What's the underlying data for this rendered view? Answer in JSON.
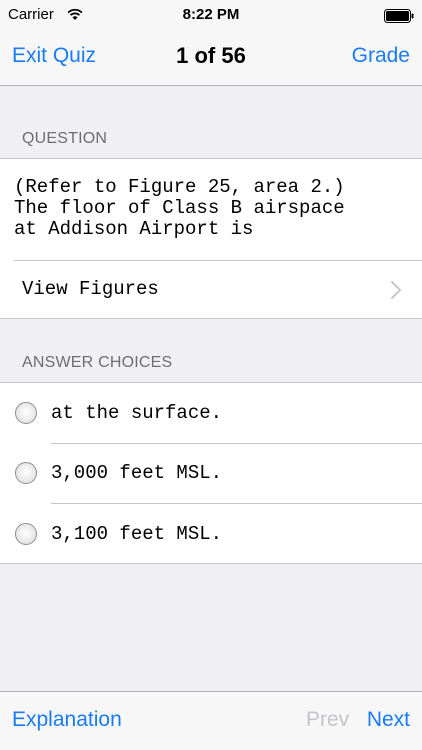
{
  "status_bar": {
    "carrier": "Carrier",
    "time": "8:22 PM"
  },
  "nav": {
    "left_label": "Exit Quiz",
    "title": "1 of 56",
    "right_label": "Grade"
  },
  "question_section": {
    "header": "QUESTION",
    "text": "(Refer to Figure 25, area 2.)\nThe floor of Class B airspace\nat Addison Airport is",
    "view_figures_label": "View Figures"
  },
  "answers_section": {
    "header": "ANSWER CHOICES",
    "choices": [
      {
        "label": "at the surface."
      },
      {
        "label": "3,000 feet MSL."
      },
      {
        "label": "3,100 feet MSL."
      }
    ]
  },
  "toolbar": {
    "explanation_label": "Explanation",
    "prev_label": "Prev",
    "next_label": "Next"
  },
  "colors": {
    "accent": "#1a7cf5",
    "disabled": "#c4c4c8",
    "background": "#efeff4"
  }
}
